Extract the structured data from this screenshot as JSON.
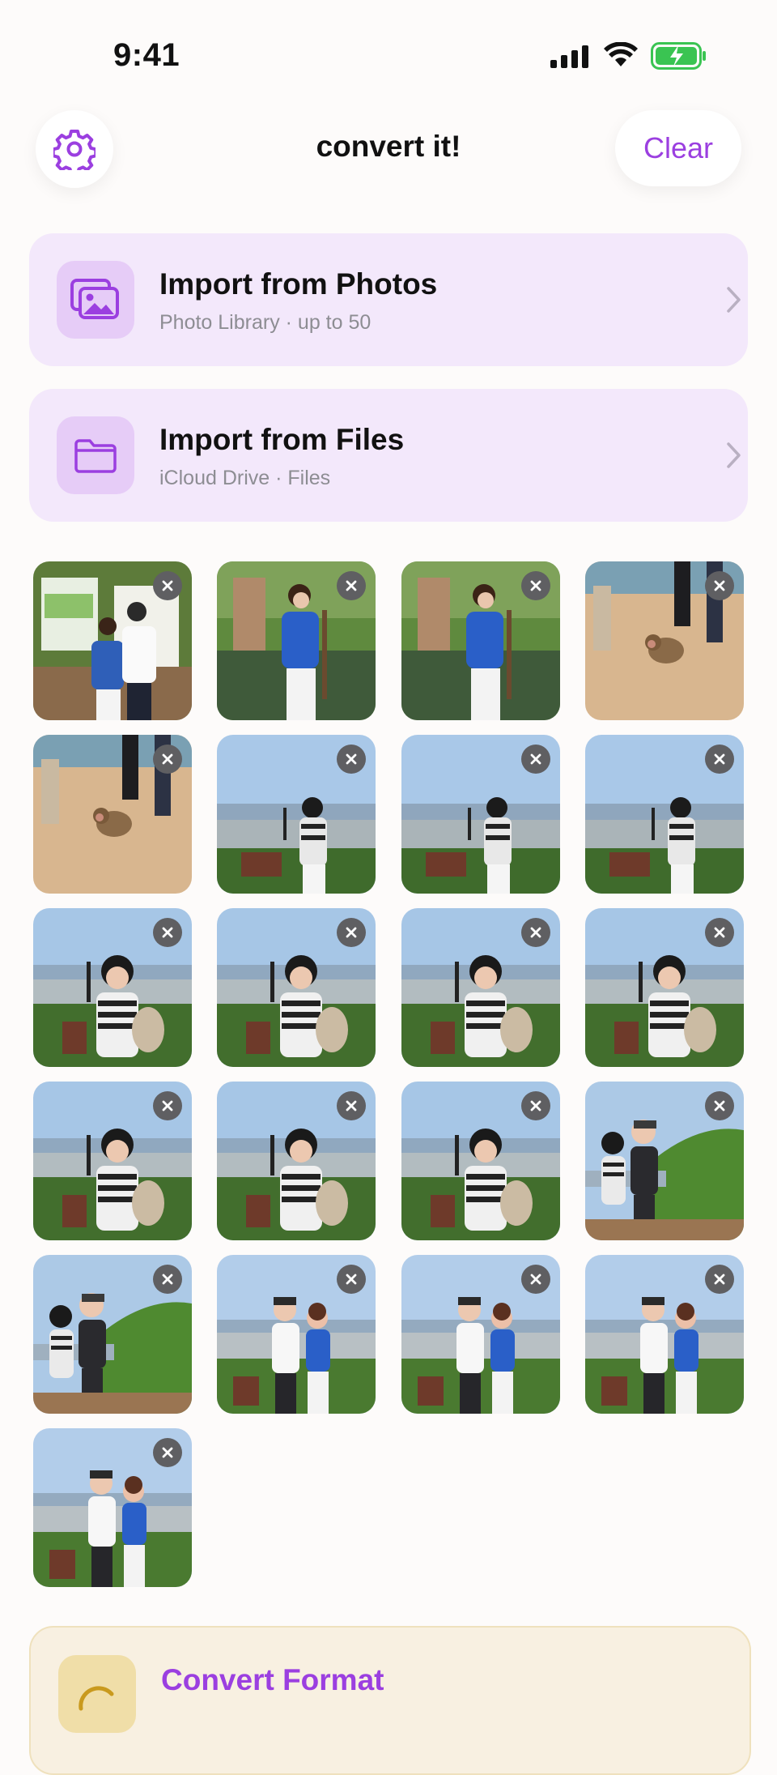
{
  "status_bar": {
    "time": "9:41"
  },
  "header": {
    "title": "convert it!",
    "clear_label": "Clear"
  },
  "import_photos": {
    "title": "Import from Photos",
    "subtitle": "Photo Library · up to 50"
  },
  "import_files": {
    "title": "Import from Files",
    "subtitle": "iCloud Drive · Files"
  },
  "convert": {
    "title": "Convert Format"
  },
  "colors": {
    "accent": "#9b3fe0",
    "card_bg": "#f3e8fb",
    "icon_bg": "#e6ccf7",
    "convert_bg": "#f8f0e1"
  },
  "thumbnails": [
    {
      "scene": "park-sign"
    },
    {
      "scene": "pond-blue"
    },
    {
      "scene": "pond-blue"
    },
    {
      "scene": "monkey"
    },
    {
      "scene": "monkey"
    },
    {
      "scene": "viewpoint-back"
    },
    {
      "scene": "viewpoint-back"
    },
    {
      "scene": "viewpoint-back"
    },
    {
      "scene": "viewpoint-selfie"
    },
    {
      "scene": "viewpoint-selfie"
    },
    {
      "scene": "viewpoint-selfie"
    },
    {
      "scene": "viewpoint-selfie"
    },
    {
      "scene": "viewpoint-selfie"
    },
    {
      "scene": "viewpoint-selfie"
    },
    {
      "scene": "viewpoint-selfie"
    },
    {
      "scene": "couple-hill"
    },
    {
      "scene": "couple-hill"
    },
    {
      "scene": "couple-city"
    },
    {
      "scene": "couple-city"
    },
    {
      "scene": "couple-city"
    },
    {
      "scene": "couple-city"
    }
  ]
}
